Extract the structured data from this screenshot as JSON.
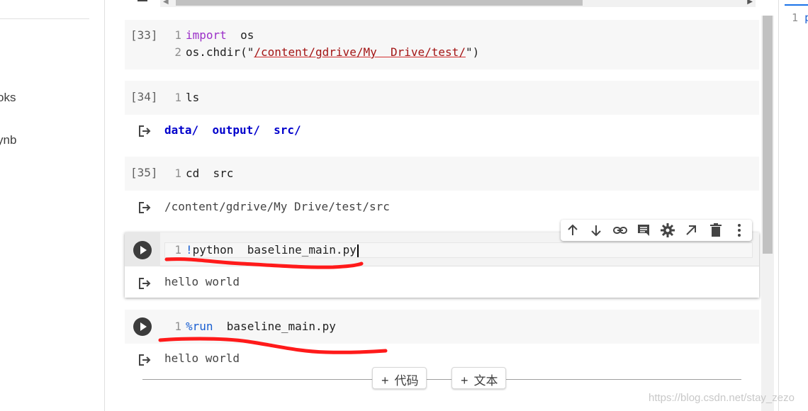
{
  "sidebar": {
    "items": [
      {
        "label": "oks"
      },
      {
        "label": "ynb"
      }
    ]
  },
  "cells": [
    {
      "exec_count": "[33]",
      "lines": [
        {
          "num": "1",
          "keyword": "import",
          "rest": "  os"
        },
        {
          "num": "2",
          "prefix": "os.chdir(\"",
          "string": "/content/gdrive/My  Drive/test/",
          "suffix": "\")"
        }
      ]
    },
    {
      "exec_count": "[34]",
      "lines": [
        {
          "num": "1",
          "text": "ls"
        }
      ],
      "output": {
        "dirs": [
          "data/",
          "output/",
          "src/"
        ]
      }
    },
    {
      "exec_count": "[35]",
      "lines": [
        {
          "num": "1",
          "text": "cd  src"
        }
      ],
      "output": {
        "text": "/content/gdrive/My Drive/test/src"
      }
    },
    {
      "lines": [
        {
          "num": "1",
          "magic": "!",
          "text": "python  baseline_main.py"
        }
      ],
      "output": {
        "text": "hello world"
      }
    },
    {
      "lines": [
        {
          "num": "1",
          "magic": "%run",
          "text": "  baseline_main.py"
        }
      ],
      "output": {
        "text": "hello world"
      }
    }
  ],
  "toolbar": {
    "icons": [
      "arrow-up-icon",
      "arrow-down-icon",
      "link-icon",
      "comment-icon",
      "gear-icon",
      "open-in-new-icon",
      "trash-icon",
      "more-vert-icon"
    ]
  },
  "add_buttons": {
    "code_label": "代码",
    "text_label": "文本",
    "plus": "+"
  },
  "right_panel": {
    "line_num": "1",
    "text": "p"
  },
  "watermark": "https://blog.csdn.net/stay_zezo",
  "colors": {
    "annotation": "#ff1a1a",
    "keyword": "#9b30c8",
    "string": "#a31515",
    "dir": "#0000cc",
    "magic": "#1a5fd1"
  }
}
